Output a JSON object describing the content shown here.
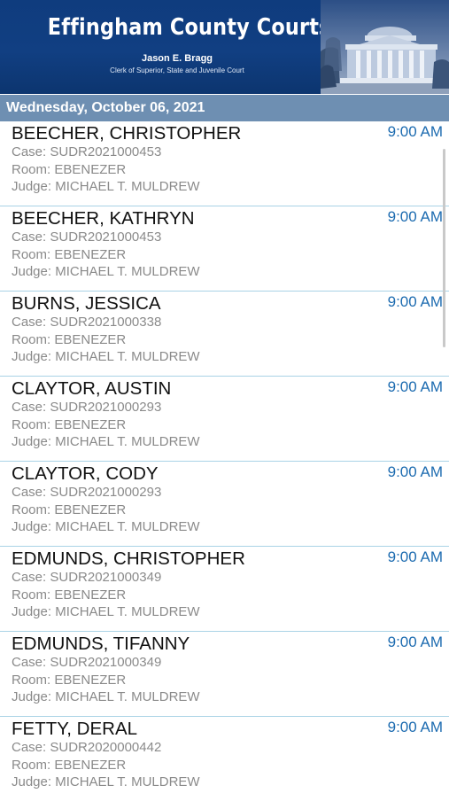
{
  "header": {
    "title": "Effingham County Courts",
    "clerk_name": "Jason E. Bragg",
    "clerk_title": "Clerk of Superior, State and Juvenile Court"
  },
  "date_label": "Wednesday, October 06, 2021",
  "labels": {
    "case": "Case:",
    "room": "Room:",
    "judge": "Judge:"
  },
  "entries": [
    {
      "name": "BEECHER, CHRISTOPHER",
      "time": "9:00 AM",
      "case": "SUDR2021000453",
      "room": "EBENEZER",
      "judge": "MICHAEL T. MULDREW"
    },
    {
      "name": "BEECHER, KATHRYN",
      "time": "9:00 AM",
      "case": "SUDR2021000453",
      "room": "EBENEZER",
      "judge": "MICHAEL T. MULDREW"
    },
    {
      "name": "BURNS, JESSICA",
      "time": "9:00 AM",
      "case": "SUDR2021000338",
      "room": "EBENEZER",
      "judge": "MICHAEL T. MULDREW"
    },
    {
      "name": "CLAYTOR, AUSTIN",
      "time": "9:00 AM",
      "case": "SUDR2021000293",
      "room": "EBENEZER",
      "judge": "MICHAEL T. MULDREW"
    },
    {
      "name": "CLAYTOR, CODY",
      "time": "9:00 AM",
      "case": "SUDR2021000293",
      "room": "EBENEZER",
      "judge": "MICHAEL T. MULDREW"
    },
    {
      "name": "EDMUNDS, CHRISTOPHER",
      "time": "9:00 AM",
      "case": "SUDR2021000349",
      "room": "EBENEZER",
      "judge": "MICHAEL T. MULDREW"
    },
    {
      "name": "EDMUNDS, TIFANNY",
      "time": "9:00 AM",
      "case": "SUDR2021000349",
      "room": "EBENEZER",
      "judge": "MICHAEL T. MULDREW"
    },
    {
      "name": "FETTY, DERAL",
      "time": "9:00 AM",
      "case": "SUDR2020000442",
      "room": "EBENEZER",
      "judge": "MICHAEL T. MULDREW"
    }
  ]
}
